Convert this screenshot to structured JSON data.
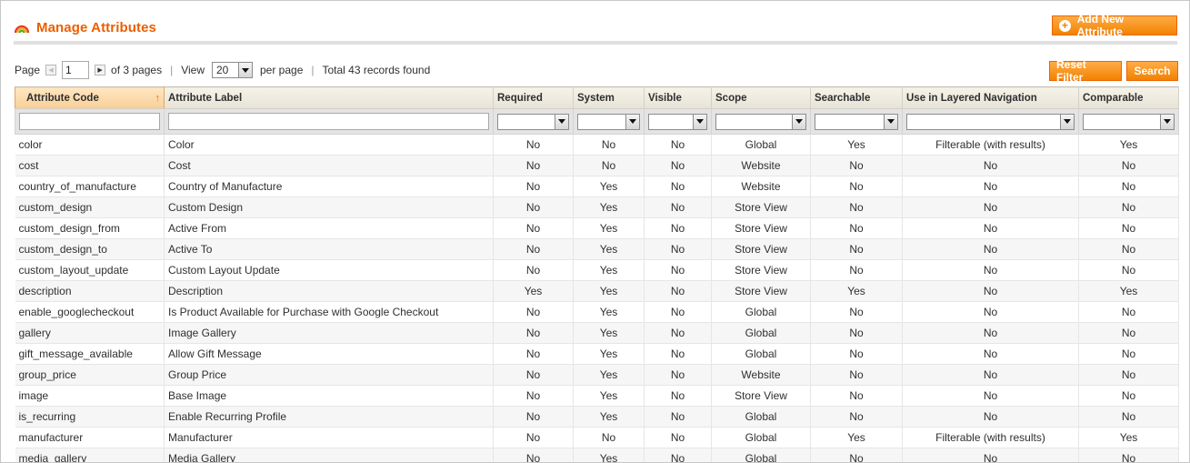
{
  "header": {
    "title": "Manage Attributes",
    "add_button": "Add New Attribute"
  },
  "pager": {
    "page_label": "Page",
    "page_value": "1",
    "of_pages": "of 3 pages",
    "view_label": "View",
    "view_value": "20",
    "per_page": "per page",
    "total": "Total 43 records found",
    "separator": "|"
  },
  "actions": {
    "reset_filter": "Reset Filter",
    "search": "Search"
  },
  "columns": [
    "Attribute Code",
    "Attribute Label",
    "Required",
    "System",
    "Visible",
    "Scope",
    "Searchable",
    "Use in Layered Navigation",
    "Comparable"
  ],
  "rows": [
    [
      "color",
      "Color",
      "No",
      "No",
      "No",
      "Global",
      "Yes",
      "Filterable (with results)",
      "Yes"
    ],
    [
      "cost",
      "Cost",
      "No",
      "No",
      "No",
      "Website",
      "No",
      "No",
      "No"
    ],
    [
      "country_of_manufacture",
      "Country of Manufacture",
      "No",
      "Yes",
      "No",
      "Website",
      "No",
      "No",
      "No"
    ],
    [
      "custom_design",
      "Custom Design",
      "No",
      "Yes",
      "No",
      "Store View",
      "No",
      "No",
      "No"
    ],
    [
      "custom_design_from",
      "Active From",
      "No",
      "Yes",
      "No",
      "Store View",
      "No",
      "No",
      "No"
    ],
    [
      "custom_design_to",
      "Active To",
      "No",
      "Yes",
      "No",
      "Store View",
      "No",
      "No",
      "No"
    ],
    [
      "custom_layout_update",
      "Custom Layout Update",
      "No",
      "Yes",
      "No",
      "Store View",
      "No",
      "No",
      "No"
    ],
    [
      "description",
      "Description",
      "Yes",
      "Yes",
      "No",
      "Store View",
      "Yes",
      "No",
      "Yes"
    ],
    [
      "enable_googlecheckout",
      "Is Product Available for Purchase with Google Checkout",
      "No",
      "Yes",
      "No",
      "Global",
      "No",
      "No",
      "No"
    ],
    [
      "gallery",
      "Image Gallery",
      "No",
      "Yes",
      "No",
      "Global",
      "No",
      "No",
      "No"
    ],
    [
      "gift_message_available",
      "Allow Gift Message",
      "No",
      "Yes",
      "No",
      "Global",
      "No",
      "No",
      "No"
    ],
    [
      "group_price",
      "Group Price",
      "No",
      "Yes",
      "No",
      "Website",
      "No",
      "No",
      "No"
    ],
    [
      "image",
      "Base Image",
      "No",
      "Yes",
      "No",
      "Store View",
      "No",
      "No",
      "No"
    ],
    [
      "is_recurring",
      "Enable Recurring Profile",
      "No",
      "Yes",
      "No",
      "Global",
      "No",
      "No",
      "No"
    ],
    [
      "manufacturer",
      "Manufacturer",
      "No",
      "No",
      "No",
      "Global",
      "Yes",
      "Filterable (with results)",
      "Yes"
    ],
    [
      "media_gallery",
      "Media Gallery",
      "No",
      "Yes",
      "No",
      "Global",
      "No",
      "No",
      "No"
    ]
  ],
  "colors": {
    "accent": "#eb5e00",
    "button": "#f18200",
    "sorted_header": "#f7cf97"
  },
  "icons": {
    "title": "rainbow-icon",
    "add": "plus-circle-icon",
    "sort": "sort-asc-arrow-icon"
  }
}
